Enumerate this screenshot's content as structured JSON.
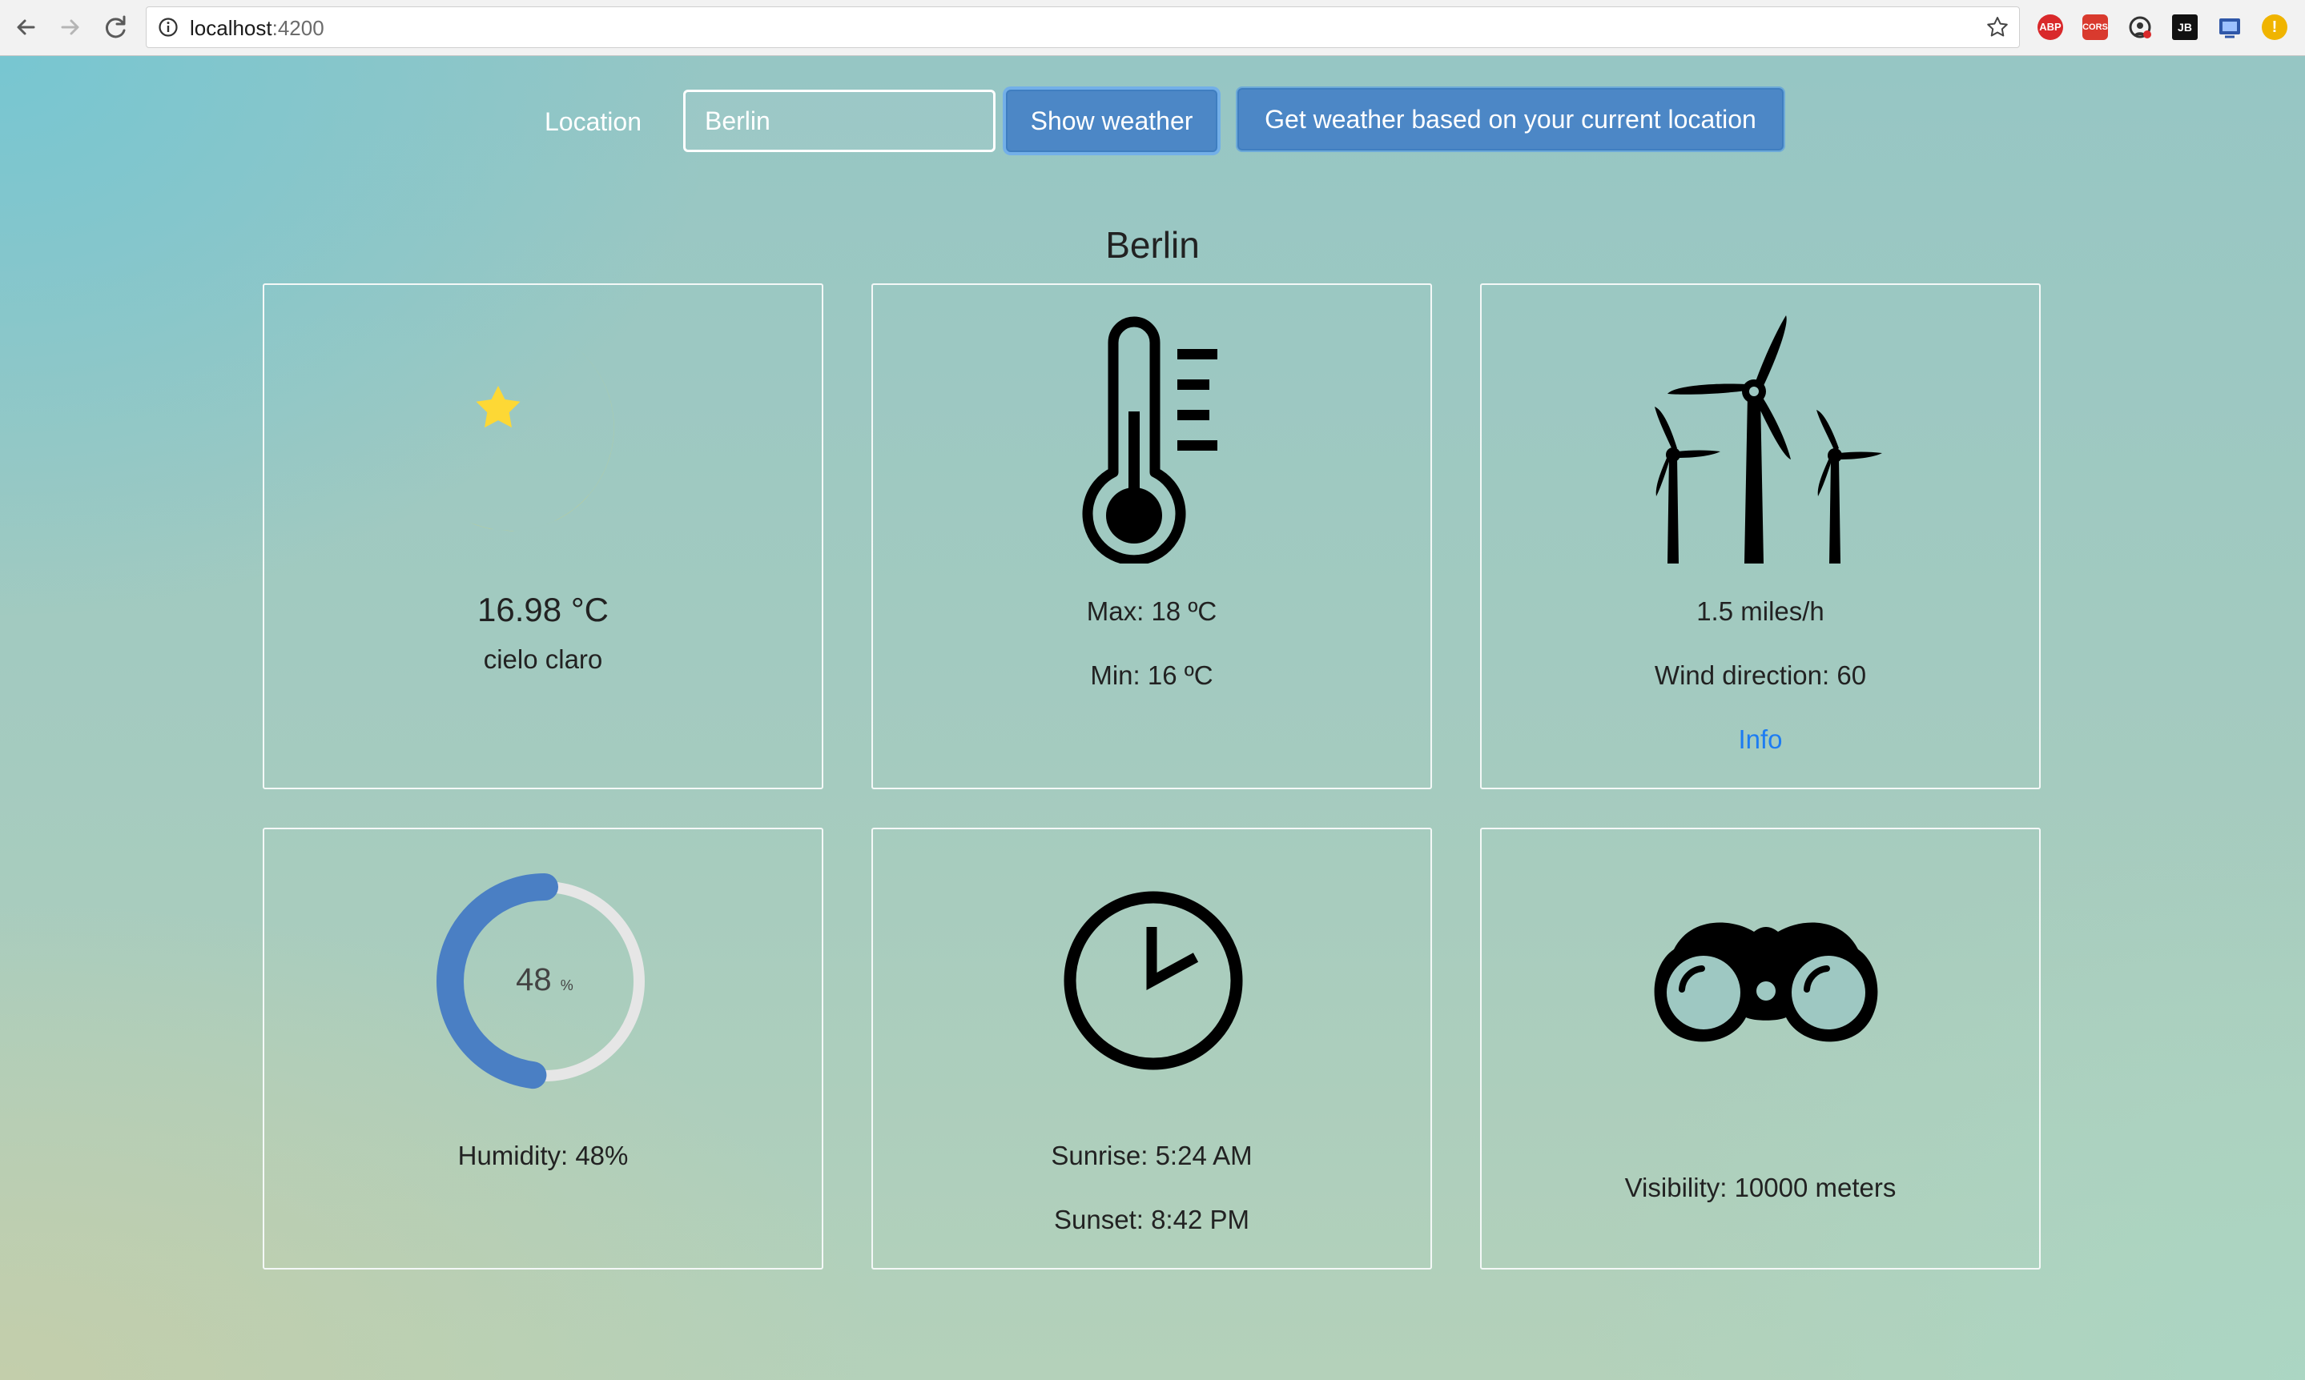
{
  "browser": {
    "url_host": "localhost",
    "url_port": ":4200",
    "extensions": [
      "ABP",
      "CORS",
      "JB"
    ]
  },
  "search": {
    "label": "Location",
    "value": "Berlin",
    "show_button": "Show weather",
    "geo_button": "Get weather based on your current location"
  },
  "city": "Berlin",
  "current": {
    "icon": "moon-star-icon",
    "temperature": "16.98 °C",
    "description": "cielo claro"
  },
  "temps": {
    "icon": "thermometer-icon",
    "max": "Max: 18 ºC",
    "min": "Min: 16 ºC"
  },
  "wind": {
    "icon": "wind-turbines-icon",
    "speed": "1.5 miles/h",
    "direction": "Wind direction: 60",
    "info_link": "Info"
  },
  "humidity": {
    "value": 48,
    "value_text": "48",
    "unit": "%",
    "label": "Humidity: 48%",
    "ring_color": "#4a7fc4",
    "track_color": "#e6e6e6"
  },
  "sun": {
    "icon": "clock-icon",
    "sunrise": "Sunrise: 5:24 AM",
    "sunset": "Sunset: 8:42 PM"
  },
  "visibility": {
    "icon": "binoculars-icon",
    "label": "Visibility: 10000 meters"
  }
}
